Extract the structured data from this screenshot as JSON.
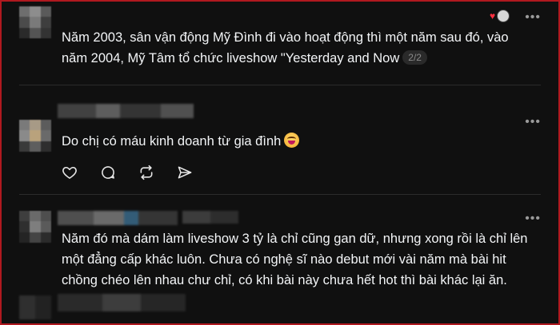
{
  "comments": [
    {
      "text": "Năm 2003, sân vận động Mỹ Đình đi vào hoạt động thì một năm sau đó, vào năm 2004, Mỹ Tâm tổ chức liveshow \"Yesterday and Now",
      "pager": "2/2",
      "more_label": "•••"
    },
    {
      "text": "Do chị có máu kinh doanh từ gia đình",
      "emoji": "grinning-face-with-tongue",
      "more_label": "•••",
      "actions": [
        "heart-icon",
        "comment-icon",
        "repost-icon",
        "share-icon"
      ]
    },
    {
      "text": "Năm đó mà dám làm liveshow 3 tỷ là chỉ cũng gan dữ, nhưng xong rồi là chỉ lên một đẳng cấp khác luôn. Chưa có nghệ sĩ nào debut mới vài năm mà bài hit chồng chéo lên nhau chư chỉ, có khi bài này chưa hết hot thì bài khác lại ăn.",
      "more_label": "•••"
    }
  ],
  "colors": {
    "background": "#101010",
    "text": "#f3f5f7",
    "muted": "#8a8a8a",
    "border": "#b0191f",
    "heart": "#ff3040"
  }
}
